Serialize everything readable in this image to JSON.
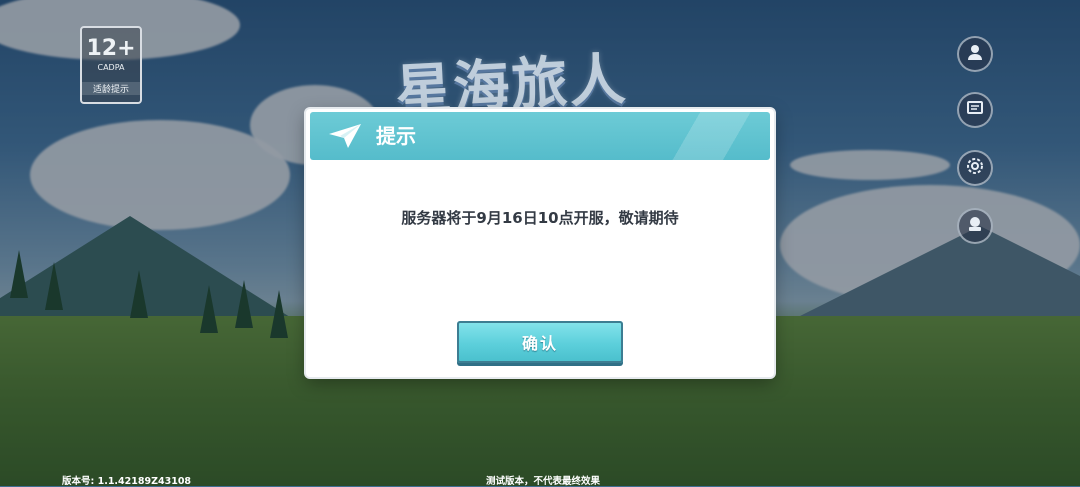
{
  "game": {
    "logo_text": "星海旅人",
    "age_rating": {
      "label": "12+",
      "sub": "CADPA",
      "tip": "适龄提示"
    }
  },
  "footer": {
    "version": "版本号: 1.1.42189Z43108",
    "test_note": "测试版本，不代表最终效果"
  },
  "dialog": {
    "title": "提示",
    "message": "服务器将于9月16日10点开服，敬请期待",
    "confirm_label": "确认"
  },
  "side_buttons": [
    {
      "icon": "avatar-icon"
    },
    {
      "icon": "notice-icon"
    },
    {
      "icon": "settings-gear-icon"
    },
    {
      "icon": "user-center-icon"
    }
  ],
  "colors": {
    "header_accent": "#55bccb",
    "button_accent": "#5ccfdb",
    "message_text": "#333a44"
  }
}
